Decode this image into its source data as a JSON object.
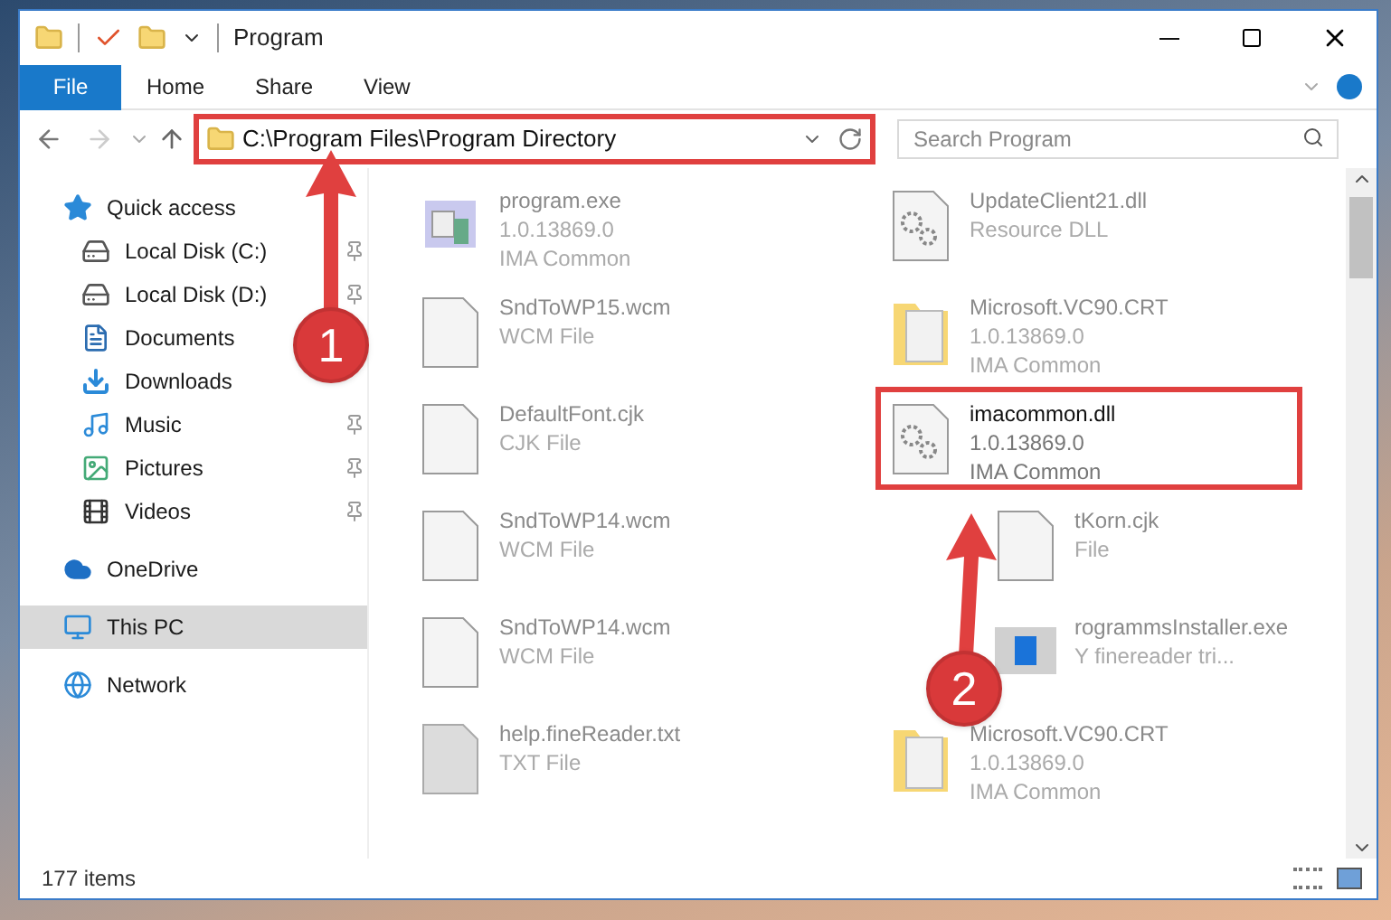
{
  "window": {
    "title": "Program"
  },
  "ribbon_tabs": [
    {
      "label": "File",
      "selected": true
    },
    {
      "label": "Home",
      "selected": false
    },
    {
      "label": "Share",
      "selected": false
    },
    {
      "label": "View",
      "selected": false
    }
  ],
  "address_bar": {
    "value": "C:\\Program Files\\Program Directory",
    "highlighted": true
  },
  "search": {
    "placeholder": "Search Program"
  },
  "sidebar": {
    "items": [
      {
        "label": "Quick access",
        "kind": "star",
        "selected": false,
        "children": [
          {
            "label": "Local Disk (C:)",
            "kind": "disk-c",
            "selected": false,
            "pinned": true
          },
          {
            "label": "Local Disk (D:)",
            "kind": "disk",
            "selected": false,
            "pinned": true
          },
          {
            "label": "Documents",
            "kind": "documents",
            "selected": false
          },
          {
            "label": "Downloads",
            "kind": "downloads",
            "selected": false
          },
          {
            "label": "Music",
            "kind": "music",
            "selected": false,
            "pinned": true
          },
          {
            "label": "Pictures",
            "kind": "pictures",
            "selected": false,
            "pinned": true
          },
          {
            "label": "Videos",
            "kind": "videos",
            "selected": false,
            "pinned": true
          }
        ]
      },
      {
        "label": "OneDrive",
        "kind": "cloud",
        "selected": false
      },
      {
        "label": "This PC",
        "kind": "pc",
        "selected": true
      },
      {
        "label": "Network",
        "kind": "network",
        "selected": false
      }
    ]
  },
  "files": [
    {
      "kind": "exe",
      "lines": [
        "program.exe",
        "1.0.13869.0",
        "IMA Common"
      ],
      "blurred": true,
      "highlighted": false
    },
    {
      "kind": "dll",
      "lines": [
        "UpdateClient21.dll",
        "Resource DLL"
      ],
      "blurred": true,
      "highlighted": false
    },
    {
      "kind": "file",
      "lines": [
        "SndToWP15.wcm",
        "WCM File"
      ],
      "blurred": true,
      "highlighted": false
    },
    {
      "kind": "folder",
      "lines": [
        "Microsoft.VC90.CRT",
        "1.0.13869.0",
        "IMA Common"
      ],
      "blurred": true,
      "highlighted": false
    },
    {
      "kind": "file",
      "lines": [
        "DefaultFont.cjk",
        "CJK File"
      ],
      "blurred": true,
      "highlighted": false
    },
    {
      "kind": "dll",
      "lines": [
        "imacommon.dll",
        "1.0.13869.0",
        "IMA Common"
      ],
      "blurred": false,
      "highlighted": true
    },
    {
      "kind": "file",
      "lines": [
        "SndToWP14.wcm",
        "WCM File"
      ],
      "blurred": true,
      "highlighted": false
    },
    {
      "kind": "file",
      "lines": [
        "tKorn.cjk",
        "File"
      ],
      "blurred": true,
      "highlighted": false
    },
    {
      "kind": "file",
      "lines": [
        "SndToWP14.wcm",
        "WCM File"
      ],
      "blurred": true,
      "highlighted": false
    },
    {
      "kind": "installer",
      "lines": [
        "rogrammsInstaller.exe",
        "Y finereader tri..."
      ],
      "blurred": true,
      "highlighted": false
    },
    {
      "kind": "txt",
      "lines": [
        "help.fineReader.txt",
        "TXT File"
      ],
      "blurred": true,
      "highlighted": false
    },
    {
      "kind": "folder",
      "lines": [
        "Microsoft.VC90.CRT",
        "1.0.13869.0",
        "IMA Common"
      ],
      "blurred": true,
      "highlighted": false
    }
  ],
  "status_bar": {
    "item_count": "177 items"
  },
  "annotations": [
    {
      "label": "1"
    },
    {
      "label": "2"
    }
  ]
}
